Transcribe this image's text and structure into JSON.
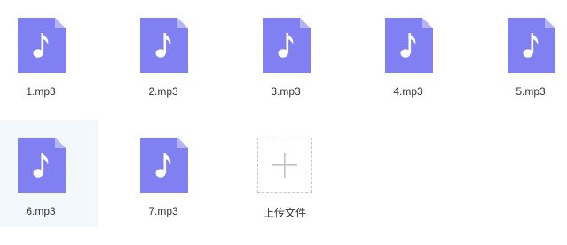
{
  "files": [
    {
      "name": "1.mp3",
      "icon": "music-file-icon"
    },
    {
      "name": "2.mp3",
      "icon": "music-file-icon"
    },
    {
      "name": "3.mp3",
      "icon": "music-file-icon"
    },
    {
      "name": "4.mp3",
      "icon": "music-file-icon"
    },
    {
      "name": "5.mp3",
      "icon": "music-file-icon"
    },
    {
      "name": "6.mp3",
      "icon": "music-file-icon"
    },
    {
      "name": "7.mp3",
      "icon": "music-file-icon"
    }
  ],
  "upload": {
    "label": "上传文件",
    "icon": "plus-icon"
  },
  "colors": {
    "file_icon": "#8080f2",
    "file_icon_fold": "#b4b4f7",
    "hover_background": "#f3f8fd",
    "dashed_border": "#c8c8c8",
    "plus": "#c0c0c0",
    "text": "#333333"
  }
}
